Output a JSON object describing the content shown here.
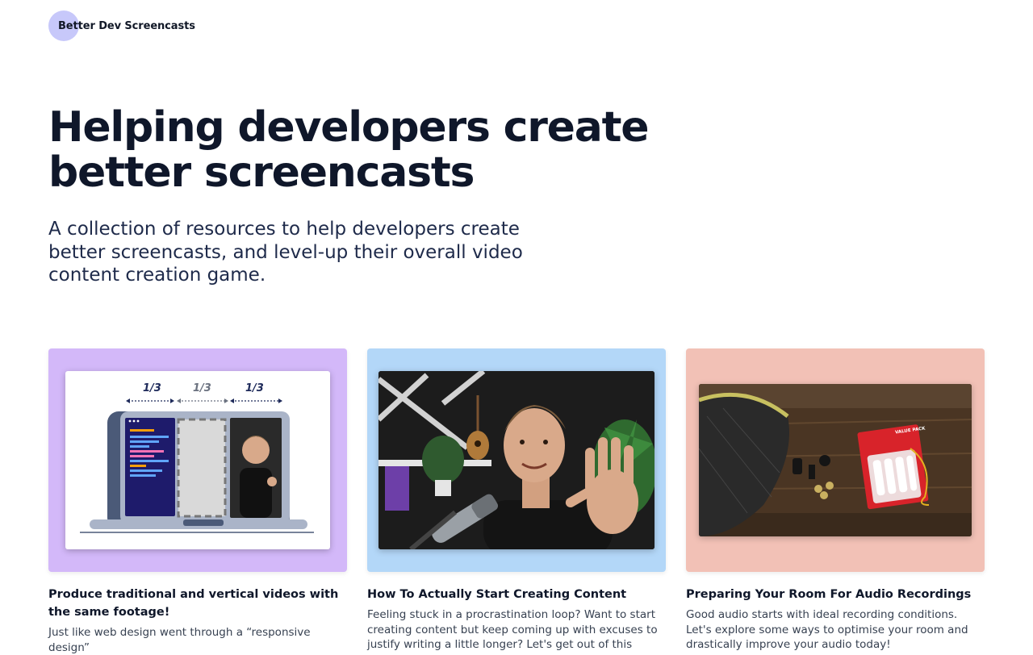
{
  "site": {
    "logo_text": "Better Dev Screencasts"
  },
  "hero": {
    "title_line1": "Helping developers create",
    "title_line2": "better screencasts",
    "subtitle": "A collection of resources to help developers create better screencasts, and level-up their overall video content creation game."
  },
  "colors": {
    "card1_bg": "#d3b8f9",
    "card2_bg": "#b3d7f8",
    "card3_bg": "#f2c1b6",
    "logo_circle": "#c7c8fa"
  },
  "cards": [
    {
      "title": "Produce traditional and vertical videos with the same footage!",
      "excerpt": "Just like web design went through a “responsive design”",
      "image": {
        "labels": [
          "1/3",
          "1/3",
          "1/3"
        ]
      }
    },
    {
      "title": "How To Actually Start Creating Content",
      "excerpt": "Feeling stuck in a procrastination loop? Want to start creating content but keep coming up with excuses to justify writing a little longer? Let's get out of this"
    },
    {
      "title": "Preparing Your Room For Audio Recordings",
      "excerpt": "Good audio starts with ideal recording conditions. Let's explore some ways to optimise your room and drastically improve your audio today!",
      "image": {
        "package_label": "VALUE PACK"
      }
    }
  ]
}
